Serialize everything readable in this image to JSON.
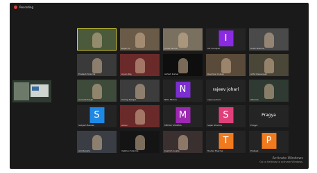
{
  "recording": {
    "label": "Recording",
    "dot_color": "#e23c3c"
  },
  "colors": {
    "speaker_border": "#d8d23a"
  },
  "participants": [
    {
      "kind": "video",
      "caption": "",
      "bg": "#4a5a3a",
      "active": true
    },
    {
      "kind": "video",
      "caption": "Rajat Vir",
      "bg": "#6a5a48"
    },
    {
      "kind": "video",
      "caption": "Jonas Verma",
      "bg": "#7a7060"
    },
    {
      "kind": "avatar",
      "letter": "I",
      "avatar_color": "#8a2be2",
      "caption": "IIIT Sonepat"
    },
    {
      "kind": "video",
      "caption": "Ankit Sharma",
      "bg": "#4a4a4a"
    },
    {
      "kind": "video",
      "caption": "Prakash Sharma",
      "bg": "#3a3a3a"
    },
    {
      "kind": "video",
      "caption": "Aryan Raj",
      "bg": "#6a2a2a"
    },
    {
      "kind": "video",
      "caption": "Ashish Kumar",
      "bg": "#0e0e0e"
    },
    {
      "kind": "video",
      "caption": "Ravinder Dubey",
      "bg": "#5a4a3a"
    },
    {
      "kind": "video",
      "caption": "Akhil Dewangan",
      "bg": "#4a4638"
    },
    {
      "kind": "video",
      "caption": "Anirudh Singh",
      "bg": "#3e4a3a"
    },
    {
      "kind": "video",
      "caption": "Chirag Sehgal",
      "bg": "#3c3c3c"
    },
    {
      "kind": "avatar",
      "letter": "N",
      "avatar_color": "#7b2fd0",
      "caption": "Nitin Mishra"
    },
    {
      "kind": "name",
      "name": "rajeev joharl",
      "caption": "rajeev joharl"
    },
    {
      "kind": "video",
      "caption": "Utkarsh",
      "bg": "#2e3a32"
    },
    {
      "kind": "avatar",
      "letter": "S",
      "avatar_color": "#1e88e5",
      "caption": "Satyam Bansal"
    },
    {
      "kind": "video",
      "caption": "Aarav",
      "bg": "#6a2a2a"
    },
    {
      "kind": "avatar",
      "letter": "M",
      "avatar_color": "#9c27b0",
      "caption": "MEHAK SHARMA"
    },
    {
      "kind": "avatar",
      "letter": "S",
      "avatar_color": "#e0407a",
      "caption": "Sajan Sharma"
    },
    {
      "kind": "name",
      "name": "Pragya",
      "caption": "Pragya"
    },
    {
      "kind": "video",
      "caption": "Amritanshu",
      "bg": "#3a3e44"
    },
    {
      "kind": "video",
      "caption": "Vaibhav Sharma",
      "bg": "#141414"
    },
    {
      "kind": "video",
      "caption": "Kashish Gupta",
      "bg": "#3a3030"
    },
    {
      "kind": "avatar",
      "letter": "T",
      "avatar_color": "#f07a1e",
      "caption": "Tushar Sharma"
    },
    {
      "kind": "avatar",
      "letter": "P",
      "avatar_color": "#f07a1e",
      "caption": "Prateek"
    }
  ],
  "watermark": {
    "title": "Activate Windows",
    "subtitle": "Go to Settings to activate Windows."
  }
}
